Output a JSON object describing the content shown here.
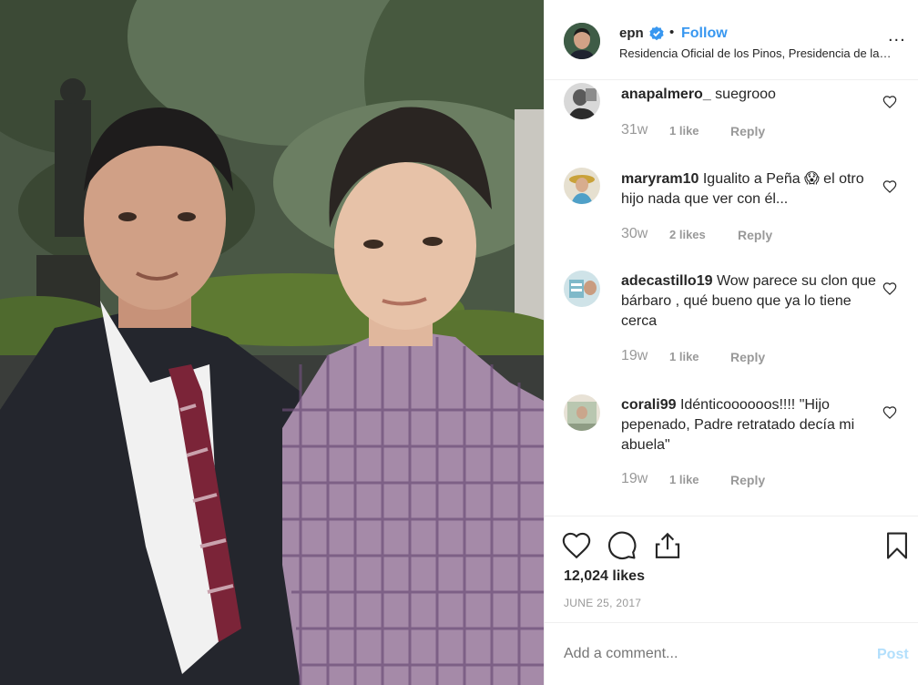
{
  "post": {
    "username": "epn",
    "follow_label": "Follow",
    "dot": "•",
    "location": "Residencia Oficial de los Pinos, Presidencia de la República",
    "more_label": "...",
    "icons": {
      "verified": "verified-badge-icon",
      "more": "more-options-icon"
    }
  },
  "comments": [
    {
      "username": "anapalmero_",
      "text": "suegrooo",
      "age": "31w",
      "likes": "1 like",
      "reply": "Reply"
    },
    {
      "username": "maryram10",
      "text": "Igualito a Peña 😱 el otro hijo nada que ver con él...",
      "age": "30w",
      "likes": "2 likes",
      "reply": "Reply"
    },
    {
      "username": "adecastillo19",
      "text": "Wow parece su clon que bárbaro , qué bueno que ya lo tiene cerca",
      "age": "19w",
      "likes": "1 like",
      "reply": "Reply"
    },
    {
      "username": "corali99",
      "text": "Idénticoooooos!!!! \"Hijo pepenado, Padre retratado decía mi abuela\"",
      "age": "19w",
      "likes": "1 like",
      "reply": "Reply"
    }
  ],
  "actions": {
    "likes_count": "12,024 likes",
    "date": "JUNE 25, 2017",
    "icons": [
      "heart-icon",
      "comment-icon",
      "share-icon",
      "bookmark-icon"
    ]
  },
  "add_comment": {
    "placeholder": "Add a comment...",
    "post_label": "Post"
  },
  "colors": {
    "accent": "#3897f0",
    "post_disabled": "#b2dffc",
    "muted": "#999999",
    "text": "#262626",
    "divider": "#efefef"
  }
}
